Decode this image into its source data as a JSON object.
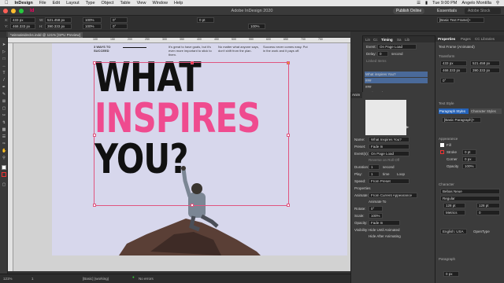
{
  "menubar": {
    "apple": "",
    "app": "InDesign",
    "items": [
      "File",
      "Edit",
      "Layout",
      "Type",
      "Object",
      "Table",
      "View",
      "Window",
      "Help"
    ],
    "clock": "Tue 9:00 PM",
    "user": "Angelo Montilla"
  },
  "titlebar": {
    "title": "Adobe InDesign 2020",
    "publish": "Publish Online",
    "workspace": "Essentials",
    "search_placeholder": "Adobe Stock"
  },
  "control": {
    "x": "433 px",
    "y": "468.333 px",
    "w": "521.458 px",
    "h": "390.333 px",
    "scale_x": "100%",
    "scale_y": "100%",
    "rotate": "0°",
    "shear": "0°",
    "stroke": "0 pt",
    "opacity": "100%",
    "frame_style": "[Basic Text Frame]+"
  },
  "document": {
    "tab": "*winnaleidecks.indd @ 121% [GPU Preview]",
    "ruler": [
      "100",
      "150",
      "200",
      "250",
      "300",
      "350",
      "400",
      "450",
      "500",
      "550",
      "600",
      "650",
      "700",
      "750",
      "800",
      "850"
    ]
  },
  "page": {
    "heading_small": "3 WAYS TO SUCCEED",
    "col1": "It's great to have goals, but it's even more important to stick to them.",
    "col2": "No matter what anyone says, don't shift from the plan.",
    "col3": "Success never comes easy. Put in the work and it pays off.",
    "line1": "WHAT",
    "line2": "INSPIRES",
    "line3": "YOU?"
  },
  "timing": {
    "tabs": [
      "Lin",
      "Cc",
      "Timing",
      "Sa",
      "Lib"
    ],
    "event_label": "Event:",
    "event": "On Page Load",
    "delay_label": "Delay:",
    "delay": "0",
    "delay_unit": "second",
    "linked_label": "Linked Items",
    "items": [
      "What inspires You?",
      "###",
      "###",
      "Inspire.psd"
    ]
  },
  "animation": {
    "title": "Anim",
    "name_label": "Name:",
    "name": "What Inspires You?",
    "preset_label": "Preset:",
    "preset": "Fade In",
    "events_label": "Event(s):",
    "events": "On Page Load",
    "reverse": "Reverse on Roll Off",
    "duration_label": "Duration:",
    "duration": "1",
    "duration_unit": "second",
    "play_label": "Play:",
    "play": "1",
    "play_unit": "time",
    "loop": "Loop",
    "speed_label": "Speed:",
    "speed": "From Preset",
    "properties": "Properties",
    "animate_label": "Animate:",
    "animate": "From Current Appearance",
    "animate_to": "Animate To",
    "rotate_label": "Rotate:",
    "rotate": "0°",
    "scale_label": "Scale:",
    "scale": "100%",
    "opacity_label": "Opacity:",
    "opacity": "Fade In",
    "visibility_label": "Visibility:",
    "hide_until": "Hide Until Animated",
    "hide_after": "Hide After Animating"
  },
  "properties": {
    "tabs": [
      "Properties",
      "Pages",
      "CC Libraries"
    ],
    "object": "Text Frame (Animated)",
    "transform": "Transform",
    "x": "433 px",
    "y": "468.333 px",
    "w": "521.458 px",
    "h": "390.333 px",
    "rotate": "0°",
    "text_style": "Text Style",
    "para_tab": "Paragraph Styles",
    "char_tab": "Character Styles",
    "para_style": "[Basic Paragraph]+",
    "appearance": "Appearance",
    "fill": "Fill",
    "stroke": "Stroke",
    "stroke_val": "0 pt",
    "corner": "Corner",
    "corner_val": "0 px",
    "opacity": "Opacity",
    "opacity_val": "100%",
    "character": "Character",
    "font": "Bebas Neue",
    "font_style": "Regular",
    "size": "128 pt",
    "leading": "128 pt",
    "kerning": "Metrics",
    "tracking": "0",
    "lang": "English: USA",
    "opentype": "OpenType",
    "paragraph": "Paragraph",
    "indent": "0 px"
  },
  "status": {
    "zoom": "121%",
    "page": "1",
    "style": "[Basic] (working)",
    "errors": "No errors"
  },
  "colors": {
    "pink": "#ef4b8f",
    "black": "#111111",
    "page": "#d7d7ec",
    "frame": "#e0557f"
  }
}
